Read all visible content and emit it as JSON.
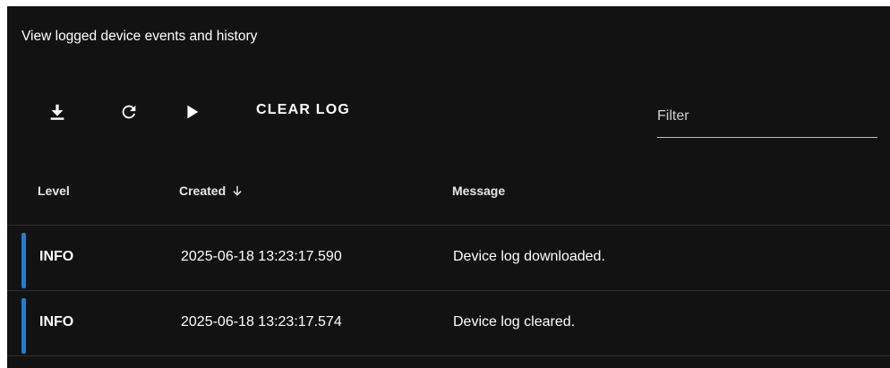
{
  "panel": {
    "subtitle": "View logged device events and history"
  },
  "toolbar": {
    "download_icon": "download-icon",
    "refresh_icon": "refresh-icon",
    "play_icon": "play-icon",
    "clear_label": "CLEAR LOG",
    "filter_placeholder": "Filter",
    "filter_value": ""
  },
  "table": {
    "columns": {
      "level": "Level",
      "created": "Created",
      "created_sort": "descending",
      "message": "Message"
    },
    "rows": [
      {
        "level": "INFO",
        "created": "2025-06-18 13:23:17.590",
        "message": "Device log downloaded."
      },
      {
        "level": "INFO",
        "created": "2025-06-18 13:23:17.574",
        "message": "Device log cleared."
      }
    ]
  },
  "colors": {
    "background": "#121212",
    "level_info": "#1a7fd4",
    "text": "#ffffff"
  }
}
